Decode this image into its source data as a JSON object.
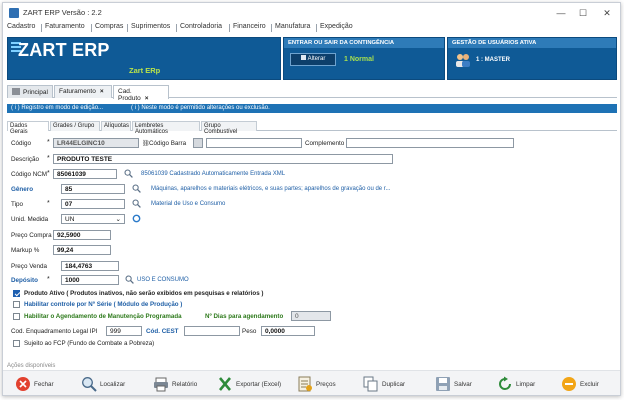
{
  "window": {
    "title": "ZART ERP Versão : 2.2"
  },
  "menu": [
    "Cadastro",
    "Faturamento",
    "Compras",
    "Suprimentos",
    "Controladoria",
    "Financeiro",
    "Manufatura",
    "Expedição"
  ],
  "header": {
    "logo": "ZART ERP",
    "logo_sub": "Zart ERp",
    "contingencia_title": "ENTRAR OU SAIR DA CONTINGÊNCIA",
    "alterar_label": "Alterar",
    "status": "1  Normal",
    "users_title": "GESTÃO DE USUÁRIOS ATIVA",
    "users_value": "1 : MASTER"
  },
  "tabs": {
    "home": "Principal",
    "t1": "Faturamento",
    "t2": "Cad. Produto"
  },
  "infobar": {
    "left": "( i ) Registro em modo de edição...",
    "right": "( i )  Neste modo é permitido alterações ou exclusão."
  },
  "subtabs": [
    "Dados Gerais",
    "Grades / Grupo",
    "Alíquotas",
    "Lembretes Automáticos",
    "Grupo Combustível"
  ],
  "form": {
    "codigo_label": "Código",
    "codigo_value": "LR44ELGINC10",
    "codigo_barra_label": "Código Barra",
    "complemento_label": "Complemento",
    "descricao_label": "Descrição",
    "descricao_value": "PRODUTO TESTE",
    "ncm_label": "Código NCM",
    "ncm_value": "85061039",
    "ncm_desc": "85061039 Cadastrado Automaticamente Entrada XML",
    "genero_label": "Gênero",
    "genero_value": "85",
    "genero_desc": "Máquinas, aparelhos e materiais elétricos, e suas partes; aparelhos de gravação ou de r...",
    "tipo_label": "Tipo",
    "tipo_value": "07",
    "tipo_desc": "Material de Uso e Consumo",
    "unid_label": "Unid. Medida",
    "unid_value": "UN",
    "preco_compra_label": "Preço Compra",
    "preco_compra_value": "92,5900",
    "markup_label": "Markup %",
    "markup_value": "99,24",
    "preco_venda_label": "Preço Venda",
    "preco_venda_value": "184,4763",
    "deposito_label": "Depósito",
    "deposito_value": "1000",
    "deposito_desc": "USO E CONSUMO",
    "chk_ativo": "Produto Ativo ( Produtos inativos, não serão exibidos em pesquisas e relatórios )",
    "chk_serie": "Habilitar controle por Nº Série ( Módulo de Produção )",
    "chk_manut": "Habilitar o Agendamento de Manutenção Programada",
    "dias_label": "Nº Dias para agendamento",
    "dias_value": "0",
    "enq_label": "Cod. Enquadramento Legal IPI",
    "enq_value": "999",
    "cest_label": "Cód. CEST",
    "peso_label": "Peso",
    "peso_value": "0,0000",
    "chk_fcp": "Sujeito ao FCP (Fundo de Combate a Pobreza)"
  },
  "actions_title": "Ações disponíveis",
  "actions": {
    "fechar": "Fechar",
    "localizar": "Localizar",
    "relatorio": "Relatório",
    "exportar": "Exportar (Excel)",
    "precos": "Preços",
    "duplicar": "Duplicar",
    "salvar": "Salvar",
    "limpar": "Limpar",
    "excluir": "Excluir"
  },
  "colors": {
    "brand_blue": "#0f5a96",
    "info_blue": "#1e72b5",
    "accent_green": "#b9e34a"
  }
}
